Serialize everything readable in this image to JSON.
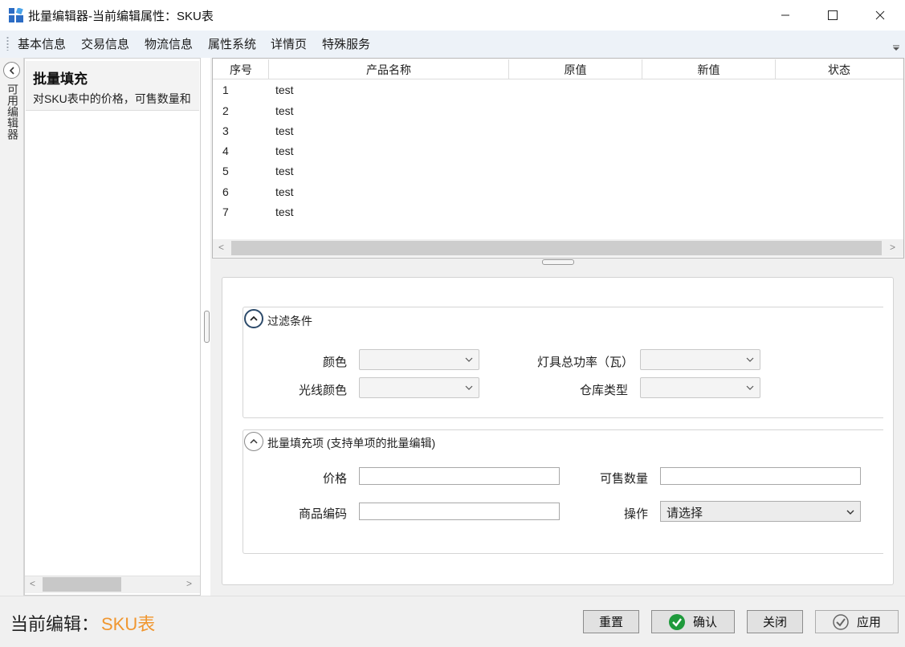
{
  "window": {
    "title": "批量编辑器-当前编辑属性：SKU表",
    "accent_color": "#0a66c2"
  },
  "tabs": [
    {
      "label": "基本信息"
    },
    {
      "label": "交易信息"
    },
    {
      "label": "物流信息"
    },
    {
      "label": "属性系统"
    },
    {
      "label": "详情页"
    },
    {
      "label": "特殊服务"
    }
  ],
  "left_strip": {
    "label": "可用编辑器",
    "collapse_icon": "chevron-left-icon"
  },
  "editor_card": {
    "title": "批量填充",
    "description": "对SKU表中的价格，可售数量和"
  },
  "table": {
    "columns": [
      "序号",
      "产品名称",
      "原值",
      "新值",
      "状态"
    ],
    "rows": [
      {
        "index": "1",
        "name": "test"
      },
      {
        "index": "2",
        "name": "test"
      },
      {
        "index": "3",
        "name": "test"
      },
      {
        "index": "4",
        "name": "test"
      },
      {
        "index": "5",
        "name": "test"
      },
      {
        "index": "6",
        "name": "test"
      },
      {
        "index": "7",
        "name": "test"
      }
    ]
  },
  "filter_group": {
    "title": "过滤条件",
    "fields": {
      "color": "颜色",
      "power": "灯具总功率（瓦）",
      "light_color": "光线颜色",
      "warehouse": "仓库类型"
    }
  },
  "fill_group": {
    "title": "批量填充项 (支持单项的批量编辑)",
    "fields": {
      "price": "价格",
      "available_qty": "可售数量",
      "product_code": "商品编码",
      "operation": "操作"
    },
    "operation_value": "请选择"
  },
  "footer": {
    "current_label": "当前编辑：",
    "current_value": "SKU表",
    "current_value_color": "#f0962f",
    "buttons": {
      "reset": "重置",
      "confirm": "确认",
      "close": "关闭",
      "apply": "应用"
    },
    "confirm_icon_color": "#1f9a3c"
  }
}
